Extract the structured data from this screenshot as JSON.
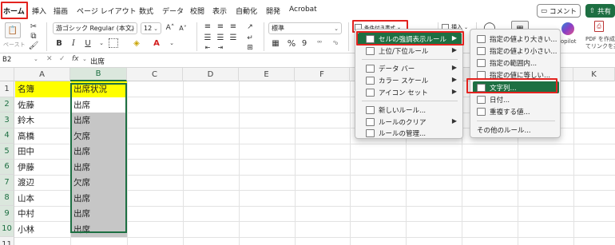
{
  "ribbon_tabs": [
    "ホーム",
    "挿入",
    "描画",
    "ページ レイアウト",
    "数式",
    "データ",
    "校閲",
    "表示",
    "自動化",
    "開発",
    "Acrobat"
  ],
  "header_buttons": {
    "comment": "コメント",
    "share": "共有"
  },
  "ribbon": {
    "paste_label": "ペースト",
    "font_name": "游ゴシック Regular (本文)",
    "font_size": "12",
    "number_format": "標準",
    "conditional_formatting": "条件付き書式",
    "insert_label": "挿入",
    "copilot_label": "Copilot",
    "pdf_label_line1": "PDF を作成",
    "pdf_label_line2": "てリンクを共",
    "bold": "B",
    "italic": "I",
    "underline": "U",
    "percent": "%"
  },
  "formula_bar": {
    "name_box": "B2",
    "fx": "fx",
    "value": "出席"
  },
  "grid": {
    "columns": [
      "A",
      "B",
      "C",
      "D",
      "E",
      "F",
      "G",
      "H",
      "I",
      "J",
      "K"
    ],
    "rows": [
      "1",
      "2",
      "3",
      "4",
      "5",
      "6",
      "7",
      "8",
      "9",
      "10",
      "11"
    ],
    "column_a": [
      "名簿",
      "佐藤",
      "鈴木",
      "高橋",
      "田中",
      "伊藤",
      "渡辺",
      "山本",
      "中村",
      "小林"
    ],
    "column_b": [
      "出席状況",
      "出席",
      "出席",
      "欠席",
      "出席",
      "出席",
      "欠席",
      "出席",
      "出席",
      "出席"
    ]
  },
  "menu_main": {
    "items": [
      "セルの強調表示ルール",
      "上位/下位ルール",
      "データ バー",
      "カラー スケール",
      "アイコン セット",
      "新しいルール...",
      "ルールのクリア",
      "ルールの管理..."
    ],
    "highlighted": "セルの強調表示ルール"
  },
  "menu_sub": {
    "items": [
      "指定の値より大きい...",
      "指定の値より小さい...",
      "指定の範囲内...",
      "指定の値に等しい...",
      "文字列...",
      "日付...",
      "重複する値...",
      "その他のルール..."
    ],
    "highlighted": "文字列..."
  },
  "colors": {
    "accent": "#1d6f42",
    "highlight_box": "#e3231f",
    "yellow_fill": "#ffff00",
    "gray_fill": "#c6c6c6"
  }
}
